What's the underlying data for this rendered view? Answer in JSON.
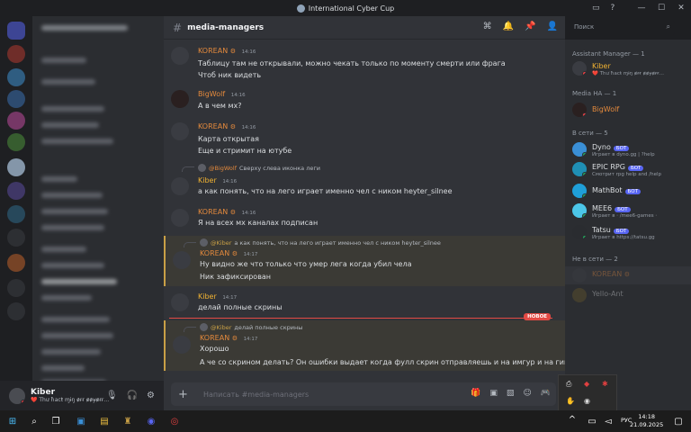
{
  "window": {
    "title": "International Cyber Cup",
    "controls": [
      "—",
      "☐",
      "✕"
    ]
  },
  "header": {
    "channel_name": "media-managers",
    "search_placeholder": "Поиск"
  },
  "messages": [
    {
      "author": "KOREAN",
      "author_color": "#e3893c",
      "has_badge": true,
      "time": "14:16",
      "lines": [
        "Таблицу там не открывали, можно чекать только по моменту смерти или фрага",
        "Чтоб ник видеть"
      ]
    },
    {
      "author": "BigWolf",
      "author_color": "#e3893c",
      "has_badge": false,
      "time": "14:16",
      "lines": [
        "А в чем мх?"
      ]
    },
    {
      "author": "KOREAN",
      "author_color": "#e3893c",
      "has_badge": true,
      "time": "14:16",
      "lines": [
        "Карта открытая",
        "Еще и стримит на ютубе"
      ]
    },
    {
      "author": "Kiber",
      "author_color": "#f0b232",
      "has_badge": false,
      "time": "14:16",
      "reply": {
        "name": "@BigWolf",
        "text": "Сверху слева иконка леги"
      },
      "lines": [
        "а как понять, что на лего играет именно чел с ником heyter_silnee"
      ]
    },
    {
      "author": "KOREAN",
      "author_color": "#e3893c",
      "has_badge": true,
      "time": "14:16",
      "lines": [
        "Я на всех мх каналах подписан"
      ]
    },
    {
      "author": "KOREAN",
      "author_color": "#e3893c",
      "has_badge": true,
      "time": "14:17",
      "highlight": true,
      "reply": {
        "name": "@Kiber",
        "text": "а как понять, что на лего играет именно чел с ником heyter_silnee"
      },
      "lines": [
        "Ну видно же что только что умер лега когда убил чела",
        "Ник зафиксирован"
      ]
    },
    {
      "author": "Kiber",
      "author_color": "#f0b232",
      "has_badge": false,
      "time": "14:17",
      "lines": [
        "делай полные скрины"
      ]
    },
    {
      "author": "KOREAN",
      "author_color": "#e3893c",
      "has_badge": true,
      "time": "14:17",
      "highlight": true,
      "reply": {
        "name": "@Kiber",
        "text": "делай полные скрины"
      },
      "lines": [
        "Хорошо",
        "А че со скрином делать? Он ошибки выдает когда фулл скрин отправляешь и на имгур и на гикпик"
      ]
    }
  ],
  "new_marker": "НОВОЕ",
  "composer": {
    "placeholder": "Написать #media-managers",
    "plus": "+"
  },
  "user_panel": {
    "name": "Kiber",
    "status": "❤️ Thư ħacŧ ɱɨŋ ɇɍɍ ɇɇɏɇɍɍ…"
  },
  "members": {
    "groups": [
      {
        "title": "Assistant Manager — 1"
      },
      {
        "title": "Media HA — 1"
      },
      {
        "title": "В сети — 5"
      },
      {
        "title": "Не в сети — 2"
      }
    ],
    "assistant": [
      {
        "name": "Kiber",
        "color": "#f0b232",
        "activity": "❤️ Thư ħacŧ ɱɨŋ ɇɍɍ ɇɇɏɇɍɍ…",
        "status_color": "#f23f43"
      }
    ],
    "media": [
      {
        "name": "BigWolf",
        "color": "#e3893c",
        "status_color": "#f23f43"
      }
    ],
    "online": [
      {
        "name": "Dyno",
        "bot_label": "БОТ",
        "activity": "Играет в dyno.gg | ?help",
        "color": "#dbdee1",
        "status_color": "#23a55a",
        "avatar_color": "#3a8fd6"
      },
      {
        "name": "EPIC RPG",
        "bot_label": "БОТ",
        "activity": "Смотрит rpg help and /help",
        "color": "#dbdee1",
        "status_color": "#23a55a",
        "avatar_color": "#1f8fb5"
      },
      {
        "name": "MathBot",
        "bot_label": "БОТ",
        "activity": "",
        "color": "#dbdee1",
        "status_color": "#23a55a",
        "avatar_color": "#1f9fd8"
      },
      {
        "name": "MEE6",
        "bot_label": "БОТ",
        "activity": "Играет в ⋅ /mee6-games ⋅",
        "color": "#dbdee1",
        "status_color": "#23a55a",
        "avatar_color": "#4cc6e8"
      },
      {
        "name": "Tatsu",
        "bot_label": "БОТ",
        "activity": "Играет в https://tatsu.gg",
        "color": "#dbdee1",
        "status_color": "#23a55a",
        "avatar_color": "#2a2c30"
      }
    ],
    "offline": [
      {
        "name": "KOREAN",
        "color": "#e3893c"
      },
      {
        "name": "Yello-Ant",
        "color": "#c9a046"
      }
    ]
  },
  "taskbar": {
    "lang": "РУС",
    "time": "14:18",
    "date": "21.09.2025"
  },
  "icons": [
    "hash-icon",
    "threads-icon",
    "bell-icon",
    "pin-icon",
    "members-icon",
    "search-icon",
    "gift-icon",
    "gif-icon",
    "sticker-icon",
    "emoji-icon",
    "controller-icon",
    "mic-icon",
    "headphones-icon",
    "gear-icon"
  ]
}
